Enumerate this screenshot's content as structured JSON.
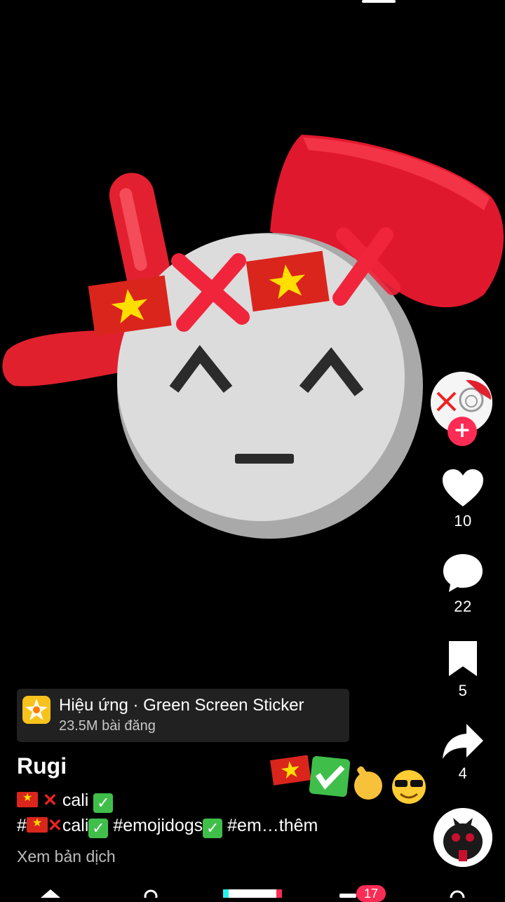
{
  "rail": {
    "likes": "10",
    "comments": "22",
    "saves": "5",
    "shares": "4",
    "follow_symbol": "+"
  },
  "effect": {
    "title": "Hiệu ứng · Green Screen Sticker",
    "posts": "23.5M bài đăng"
  },
  "post": {
    "username": "Rugi",
    "caption_line1_text": " cali ",
    "caption_line2": {
      "hash": "#",
      "tag1": "cali",
      "tag2": " #emojidogs",
      "rest": " #em…thêm"
    },
    "translate_label": "Xem bản dịch"
  },
  "nav": {
    "inbox_badge": "17"
  },
  "colors": {
    "accent": "#fe2c55",
    "flag_red": "#da251d",
    "flag_star": "#ffde00",
    "cap_red": "#e0202d"
  },
  "icons": [
    "heart-icon",
    "comment-icon",
    "bookmark-icon",
    "share-icon",
    "sparkle-icon"
  ]
}
